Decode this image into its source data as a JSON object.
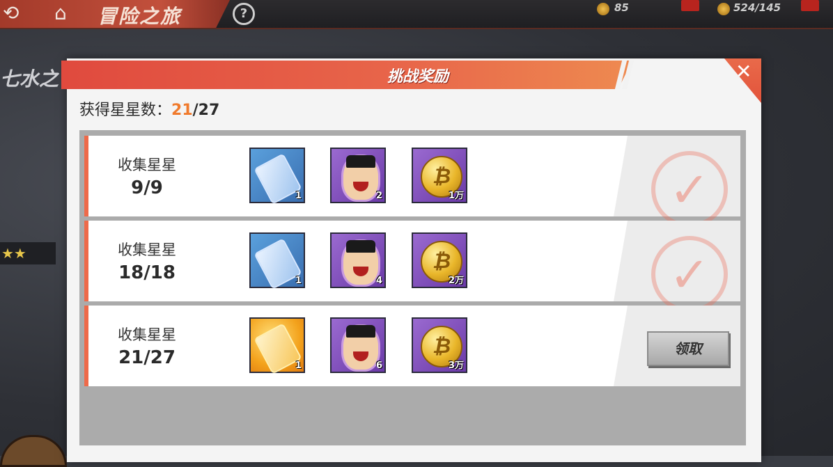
{
  "topbar": {
    "title": "冒险之旅",
    "help": "?",
    "resource_1": "85",
    "resource_2": "524/145"
  },
  "background": {
    "side_text": "七水之",
    "side_stars": "★★"
  },
  "dialog": {
    "title": "挑战奖励",
    "star_count_label": "获得星星数：",
    "star_count_current": "21",
    "star_count_total": "/27"
  },
  "rows": [
    {
      "label": "收集星星",
      "progress": "9/9",
      "status": "claimed",
      "items": [
        {
          "icon": "ticket-icon",
          "quantity": "1"
        },
        {
          "icon": "character-puzzle-icon",
          "quantity": "2"
        },
        {
          "icon": "gold-coin-icon",
          "quantity": "1万"
        }
      ]
    },
    {
      "label": "收集星星",
      "progress": "18/18",
      "status": "claimed",
      "items": [
        {
          "icon": "ticket-icon",
          "quantity": "1"
        },
        {
          "icon": "character-puzzle-icon",
          "quantity": "4"
        },
        {
          "icon": "gold-coin-icon",
          "quantity": "2万"
        }
      ]
    },
    {
      "label": "收集星星",
      "progress": "21/27",
      "status": "claimable",
      "button": "领取",
      "items": [
        {
          "icon": "gold-ticket-icon",
          "quantity": "1"
        },
        {
          "icon": "character-puzzle-icon",
          "quantity": "6"
        },
        {
          "icon": "gold-coin-icon",
          "quantity": "3万"
        }
      ]
    }
  ],
  "colors": {
    "accent": "#ee6a4a",
    "highlight": "#f07a2c",
    "header": "#e04a3e"
  }
}
